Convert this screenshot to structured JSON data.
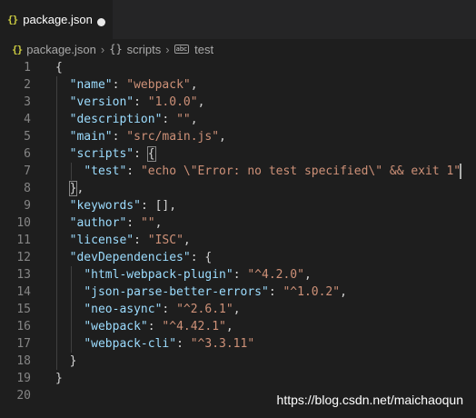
{
  "tab": {
    "filename": "package.json"
  },
  "breadcrumb": {
    "file": "package.json",
    "node1": "scripts",
    "node2": "test"
  },
  "line_numbers": [
    "1",
    "2",
    "3",
    "4",
    "5",
    "6",
    "7",
    "8",
    "9",
    "10",
    "11",
    "12",
    "13",
    "14",
    "15",
    "16",
    "17",
    "18",
    "19",
    "20"
  ],
  "lines": [
    "{",
    "  \"name\": \"webpack\",",
    "  \"version\": \"1.0.0\",",
    "  \"description\": \"\",",
    "  \"main\": \"src/main.js\",",
    "  \"scripts\": {",
    "    \"test\": \"echo \\\"Error: no test specified\\\" && exit 1\"",
    "  },",
    "  \"keywords\": [],",
    "  \"author\": \"\",",
    "  \"license\": \"ISC\",",
    "  \"devDependencies\": {",
    "    \"html-webpack-plugin\": \"^4.2.0\",",
    "    \"json-parse-better-errors\": \"^1.0.2\",",
    "    \"neo-async\": \"^2.6.1\",",
    "    \"webpack\": \"^4.42.1\",",
    "    \"webpack-cli\": \"^3.3.11\"",
    "  }",
    "}",
    ""
  ],
  "watermark": "https://blog.csdn.net/maichaoqun",
  "colors": {
    "key": "#9cdcfe",
    "string": "#ce9178",
    "punctuation": "#d4d4d4",
    "line_number": "#858585",
    "json_icon": "#cbcb41",
    "background": "#1e1e1e"
  }
}
